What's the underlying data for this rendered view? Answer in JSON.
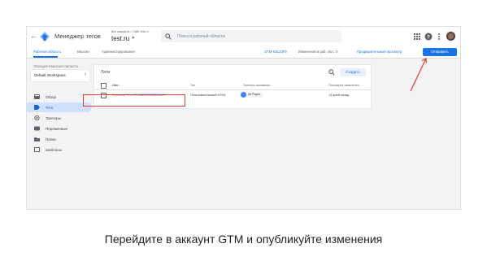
{
  "header": {
    "app_title": "Менеджер тегов",
    "breadcrumb": "Все аккаунты > Сайт test.ru",
    "container": "test.ru",
    "search_placeholder": "Поиск в рабочей области"
  },
  "subbar": {
    "tabs": [
      "Рабочая область",
      "Версии",
      "Администрирование"
    ],
    "gtm_id": "GTM-K5L23F9",
    "changes": "Изменений в раб. обл.: 0",
    "preview": "Предварительный просмотр",
    "submit": "Отправить"
  },
  "workspace": {
    "label": "ТЕКУЩАЯ РАБОЧАЯ ОБЛАСТЬ",
    "name": "Default Workspace"
  },
  "nav": [
    {
      "label": "Обзор",
      "icon": "overview-icon",
      "selected": false
    },
    {
      "label": "Теги",
      "icon": "tag-icon",
      "selected": true
    },
    {
      "label": "Триггеры",
      "icon": "trigger-icon",
      "selected": false
    },
    {
      "label": "Переменные",
      "icon": "variables-icon",
      "selected": false
    },
    {
      "label": "Папки",
      "icon": "folder-icon",
      "selected": false
    },
    {
      "label": "Шаблоны",
      "icon": "template-icon",
      "selected": false
    }
  ],
  "tags_card": {
    "title": "Теги",
    "new_button": "Создать",
    "columns": {
      "name": "Имя ↑",
      "type": "Тип",
      "trigger": "Триггеры активации",
      "edited": "Последние изменения"
    },
    "rows": [
      {
        "name": "Facebook Pixel ID 1665209652214469",
        "type": "Пользовательский HTML",
        "trigger": "All Pages",
        "edited": "13 дней назад"
      }
    ]
  },
  "caption": "Перейдите в аккаунт GTM и опубликуйте изменения",
  "colors": {
    "accent": "#1a73e8",
    "highlight": "#e53935",
    "selected_nav": "#cfe1fb"
  }
}
